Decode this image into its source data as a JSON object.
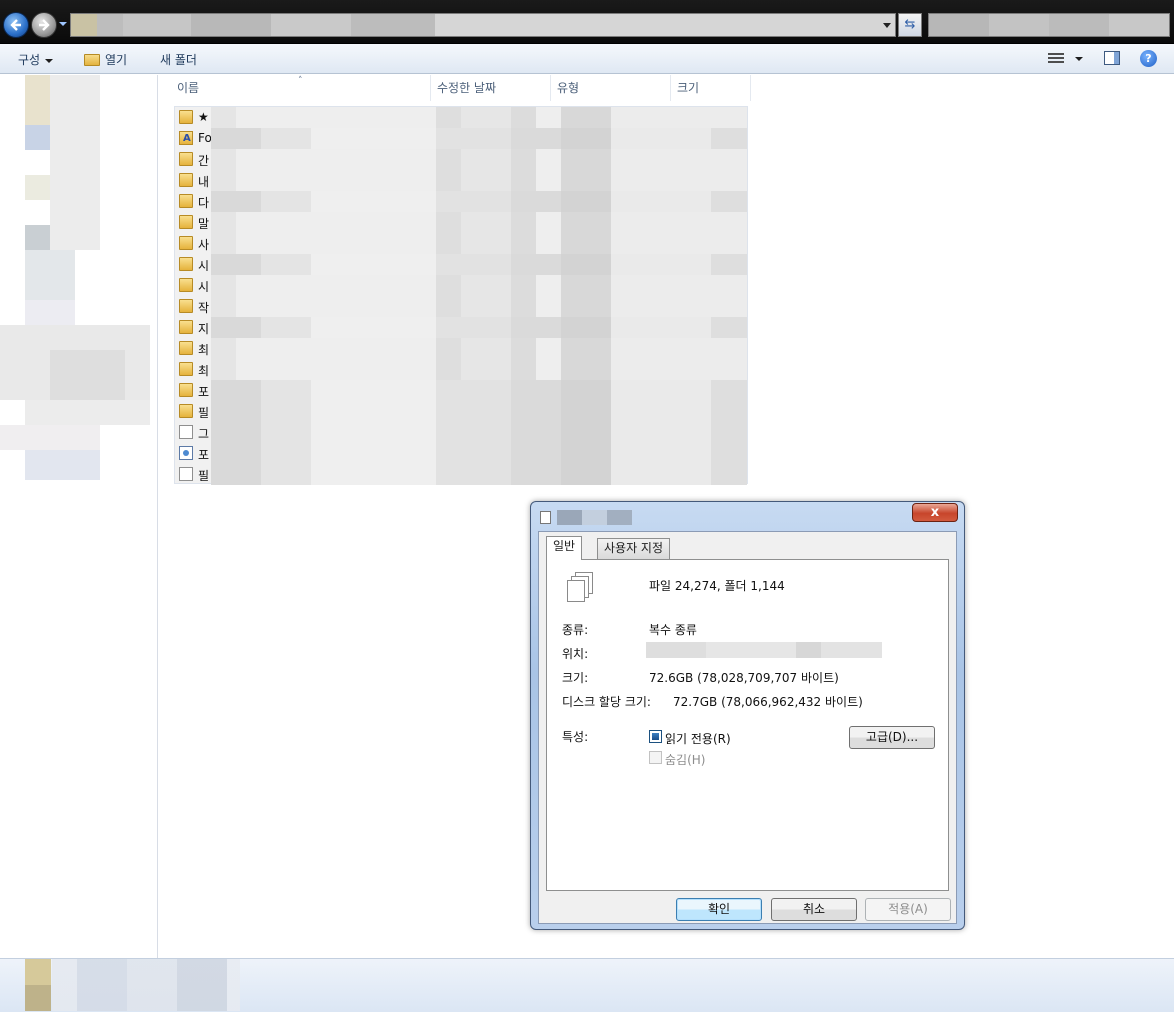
{
  "toolbar": {
    "organize_label": "구성",
    "open_label": "열기",
    "new_folder_label": "새 폴더"
  },
  "columns": {
    "name": "이름",
    "date_modified": "수정한 날짜",
    "type": "유형",
    "size": "크기"
  },
  "file_rows": [
    {
      "icon": "folder-icon",
      "name": "★"
    },
    {
      "icon": "font-folder-icon",
      "name": "Fo"
    },
    {
      "icon": "folder-icon",
      "name": "간"
    },
    {
      "icon": "folder-icon",
      "name": "내"
    },
    {
      "icon": "folder-icon",
      "name": "다"
    },
    {
      "icon": "folder-icon",
      "name": "말"
    },
    {
      "icon": "folder-icon",
      "name": "사"
    },
    {
      "icon": "folder-icon",
      "name": "시"
    },
    {
      "icon": "folder-icon",
      "name": "시"
    },
    {
      "icon": "folder-icon",
      "name": "작"
    },
    {
      "icon": "folder-icon",
      "name": "지"
    },
    {
      "icon": "folder-icon",
      "name": "최"
    },
    {
      "icon": "folder-icon",
      "name": "최"
    },
    {
      "icon": "folder-icon",
      "name": "포"
    },
    {
      "icon": "folder-icon",
      "name": "필"
    },
    {
      "icon": "file-icon",
      "name": "그"
    },
    {
      "icon": "app-icon",
      "name": "포"
    },
    {
      "icon": "file-icon",
      "name": "필"
    }
  ],
  "dialog": {
    "close_glyph": "x",
    "tabs": {
      "general": "일반",
      "custom": "사용자 지정"
    },
    "summary": "파일 24,274, 폴더 1,144",
    "type_label": "종류:",
    "type_value": "복수 종류",
    "location_label": "위치:",
    "size_label": "크기:",
    "size_value": "72.6GB (78,028,709,707 바이트)",
    "disk_size_label": "디스크 할당 크기:",
    "disk_size_value": "72.7GB (78,066,962,432 바이트)",
    "attributes_label": "특성:",
    "readonly_label": "읽기 전용(R)",
    "hidden_label": "숨김(H)",
    "advanced_button": "고급(D)...",
    "ok_button": "확인",
    "cancel_button": "취소",
    "apply_button": "적용(A)"
  }
}
